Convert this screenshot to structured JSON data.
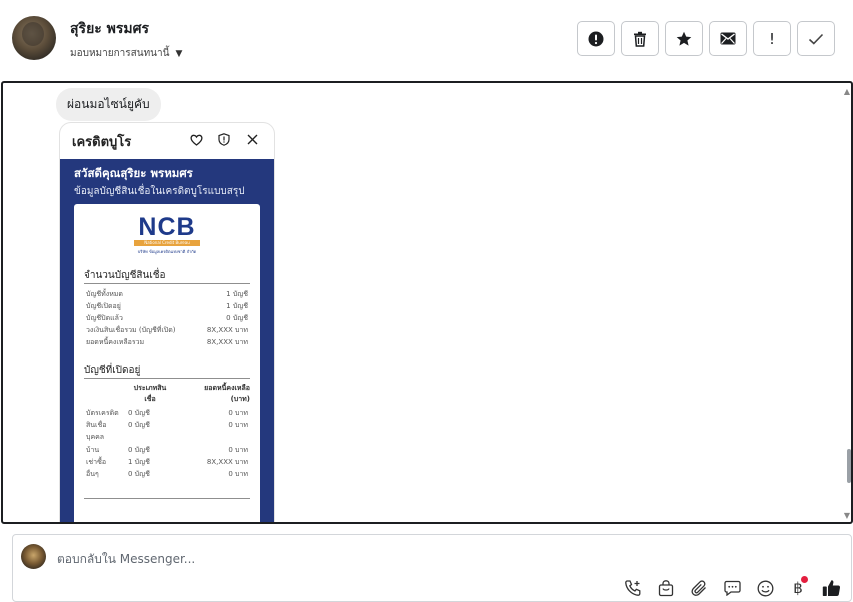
{
  "header": {
    "contact_name": "สุริยะ พรมศร",
    "assign_label": "มอบหมายการสนทนานี้",
    "actions": [
      {
        "name": "report-icon",
        "glyph": "!"
      },
      {
        "name": "trash-icon",
        "glyph": "🗑"
      },
      {
        "name": "star-icon",
        "glyph": "★"
      },
      {
        "name": "mail-icon",
        "glyph": "✉"
      },
      {
        "name": "exclamation-icon",
        "glyph": "!"
      },
      {
        "name": "check-icon",
        "glyph": "✓"
      }
    ]
  },
  "message": {
    "bubble_text": "ผ่อนมอไซน์ยูคับ"
  },
  "attachment": {
    "app_title": "เครดิตบูโร",
    "greeting": "สวัสดีคุณสุริยะ พรหมศร",
    "greeting_sub": "ข้อมูลบัญชีสินเชื่อในเครดิตบูโรแบบสรุป",
    "logo": {
      "word": "NCB",
      "band": "National Credit Bureau",
      "sub": "บริษัท ข้อมูลเครดิตแห่งชาติ จำกัด"
    },
    "summary_title": "จำนวนบัญชีสินเชื่อ",
    "summary_rows": [
      {
        "label": "บัญชีทั้งหมด",
        "value": "1 บัญชี"
      },
      {
        "label": "บัญชีเปิดอยู่",
        "value": "1 บัญชี"
      },
      {
        "label": "บัญชีปิดแล้ว",
        "value": "0 บัญชี"
      },
      {
        "label": "วงเงินสินเชื่อรวม (บัญชีที่เปิด)",
        "value": "8X,XXX  บาท"
      },
      {
        "label": "ยอดหนี้คงเหลือรวม",
        "value": "8X,XXX  บาท"
      }
    ],
    "open_title": "บัญชีที่เปิดอยู่",
    "open_headers": {
      "type": "ประเภทสิน\nเชื่อ",
      "balance": "ยอดหนี้คงเหลือ\n(บาท)"
    },
    "open_rows": [
      {
        "type": "บัตรเครดิต",
        "count": "0 บัญชี",
        "amount": "0 บาท"
      },
      {
        "type": "สินเชื่อ",
        "count": "0 บัญชี",
        "amount": "0 บาท"
      },
      {
        "type": "บุคคล",
        "count": "",
        "amount": ""
      },
      {
        "type": "บ้าน",
        "count": "0 บัญชี",
        "amount": "0 บาท"
      },
      {
        "type": "เช่าซื้อ",
        "count": "1 บัญชี",
        "amount": "8X,XXX บาท"
      },
      {
        "type": "อื่นๆ",
        "count": "0 บัญชี",
        "amount": "0 บาท"
      }
    ]
  },
  "composer": {
    "placeholder": "ตอบกลับใน Messenger...",
    "tools": [
      "phone-plus-icon",
      "shopping-bag-icon",
      "paperclip-icon",
      "chat-icon",
      "emoji-icon",
      "baht-icon",
      "thumbs-up-icon"
    ]
  }
}
